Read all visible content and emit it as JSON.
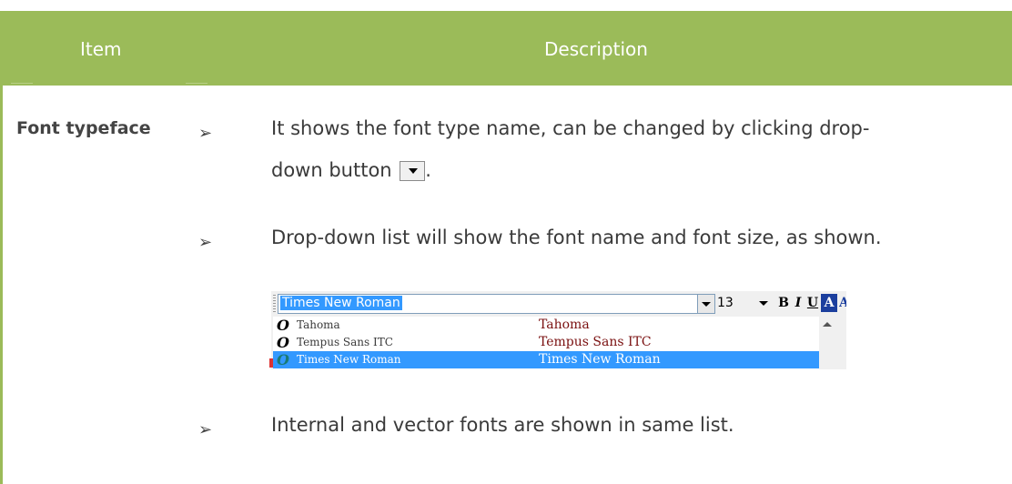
{
  "header": {
    "item_label": "Item",
    "description_label": "Description"
  },
  "rows": [
    {
      "term": "Font typeface",
      "bullets": [
        {
          "symbol": "➢",
          "text_before": "It shows the font type name, can be changed by clicking drop-",
          "text_line2": "down button",
          "text_after": "."
        },
        {
          "symbol": "➢",
          "text": "Drop-down list will show the font name and font size, as shown."
        },
        {
          "symbol": "➢",
          "text": "Internal and vector fonts are shown in same list."
        }
      ]
    }
  ],
  "font_toolbar": {
    "selected_font": "Times New Roman",
    "font_size": "13",
    "bold_label": "B",
    "italic_label": "I",
    "underline_label": "U",
    "color_label": "A",
    "size_label": "A",
    "font_list": [
      {
        "name": "Tahoma",
        "preview": "Tahoma",
        "selected": false
      },
      {
        "name": "Tempus Sans ITC",
        "preview": "Tempus Sans ITC",
        "selected": false
      },
      {
        "name": "Times New Roman",
        "preview": "Times New Roman",
        "selected": true
      }
    ],
    "font_type_icon": "opentype-o-icon"
  },
  "colors": {
    "header_bg": "#9bbb59",
    "header_text": "#ffffff",
    "selection": "#3399ff"
  }
}
